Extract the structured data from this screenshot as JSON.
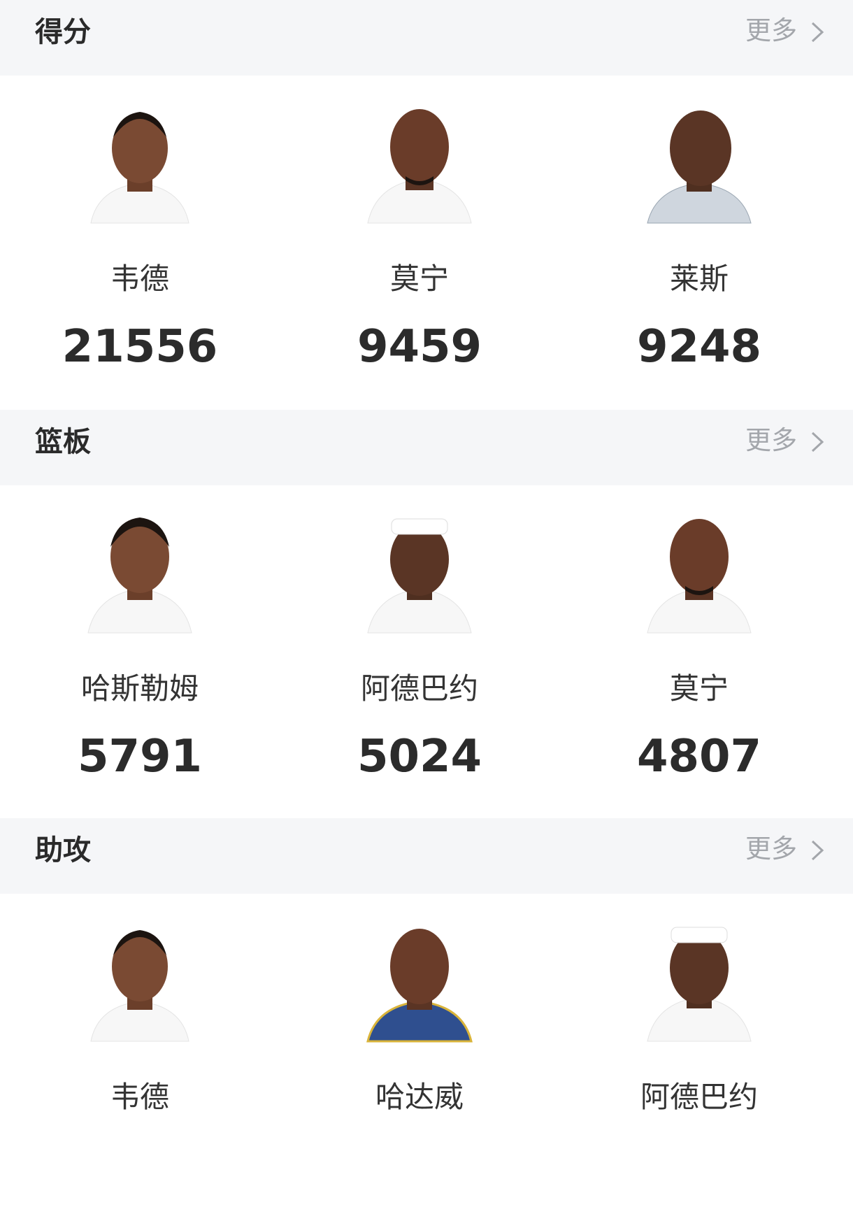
{
  "more_label": "更多",
  "sections": [
    {
      "title": "得分",
      "players": [
        {
          "name": "韦德",
          "value": "21556"
        },
        {
          "name": "莫宁",
          "value": "9459"
        },
        {
          "name": "莱斯",
          "value": "9248"
        }
      ]
    },
    {
      "title": "篮板",
      "players": [
        {
          "name": "哈斯勒姆",
          "value": "5791"
        },
        {
          "name": "阿德巴约",
          "value": "5024"
        },
        {
          "name": "莫宁",
          "value": "4807"
        }
      ]
    },
    {
      "title": "助攻",
      "players": [
        {
          "name": "韦德",
          "value": ""
        },
        {
          "name": "哈达威",
          "value": ""
        },
        {
          "name": "阿德巴约",
          "value": ""
        }
      ]
    }
  ],
  "icons": {
    "chevron": "chevron-right-icon",
    "avatar": "player-photo"
  },
  "colors": {
    "header_bg": "#f5f6f8",
    "more_text": "#a3a6ab",
    "value_text": "#2b2b2b"
  }
}
